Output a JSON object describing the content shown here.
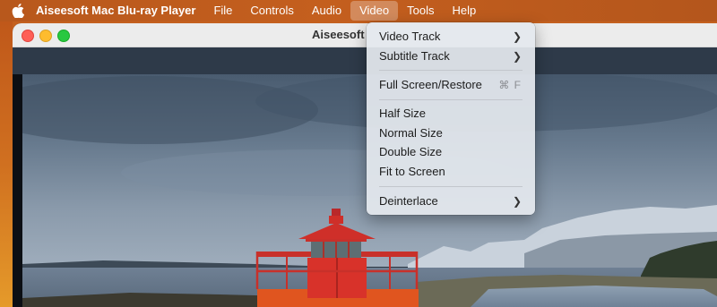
{
  "menubar": {
    "app_name": "Aiseesoft Mac Blu-ray Player",
    "items": [
      "File",
      "Controls",
      "Audio",
      "Video",
      "Tools",
      "Help"
    ],
    "active_item": "Video"
  },
  "window": {
    "title": "Aiseesoft",
    "traffic_lights": {
      "close": "#fe5f57",
      "minimize": "#febc2e",
      "maximize": "#28c840"
    }
  },
  "video_menu": {
    "video_track": {
      "label": "Video Track",
      "icon": "chevron-right-icon"
    },
    "subtitle_track": {
      "label": "Subtitle Track",
      "icon": "chevron-right-icon"
    },
    "full_screen": {
      "label": "Full Screen/Restore",
      "shortcut": "⌘ F"
    },
    "half_size": {
      "label": "Half Size"
    },
    "normal_size": {
      "label": "Normal Size"
    },
    "double_size": {
      "label": "Double Size"
    },
    "fit_to_screen": {
      "label": "Fit to Screen"
    },
    "deinterlace": {
      "label": "Deinterlace",
      "icon": "chevron-right-icon"
    }
  },
  "video_frame": {
    "subject": "red-lighthouse",
    "lighthouse_color": "#d8322a"
  }
}
